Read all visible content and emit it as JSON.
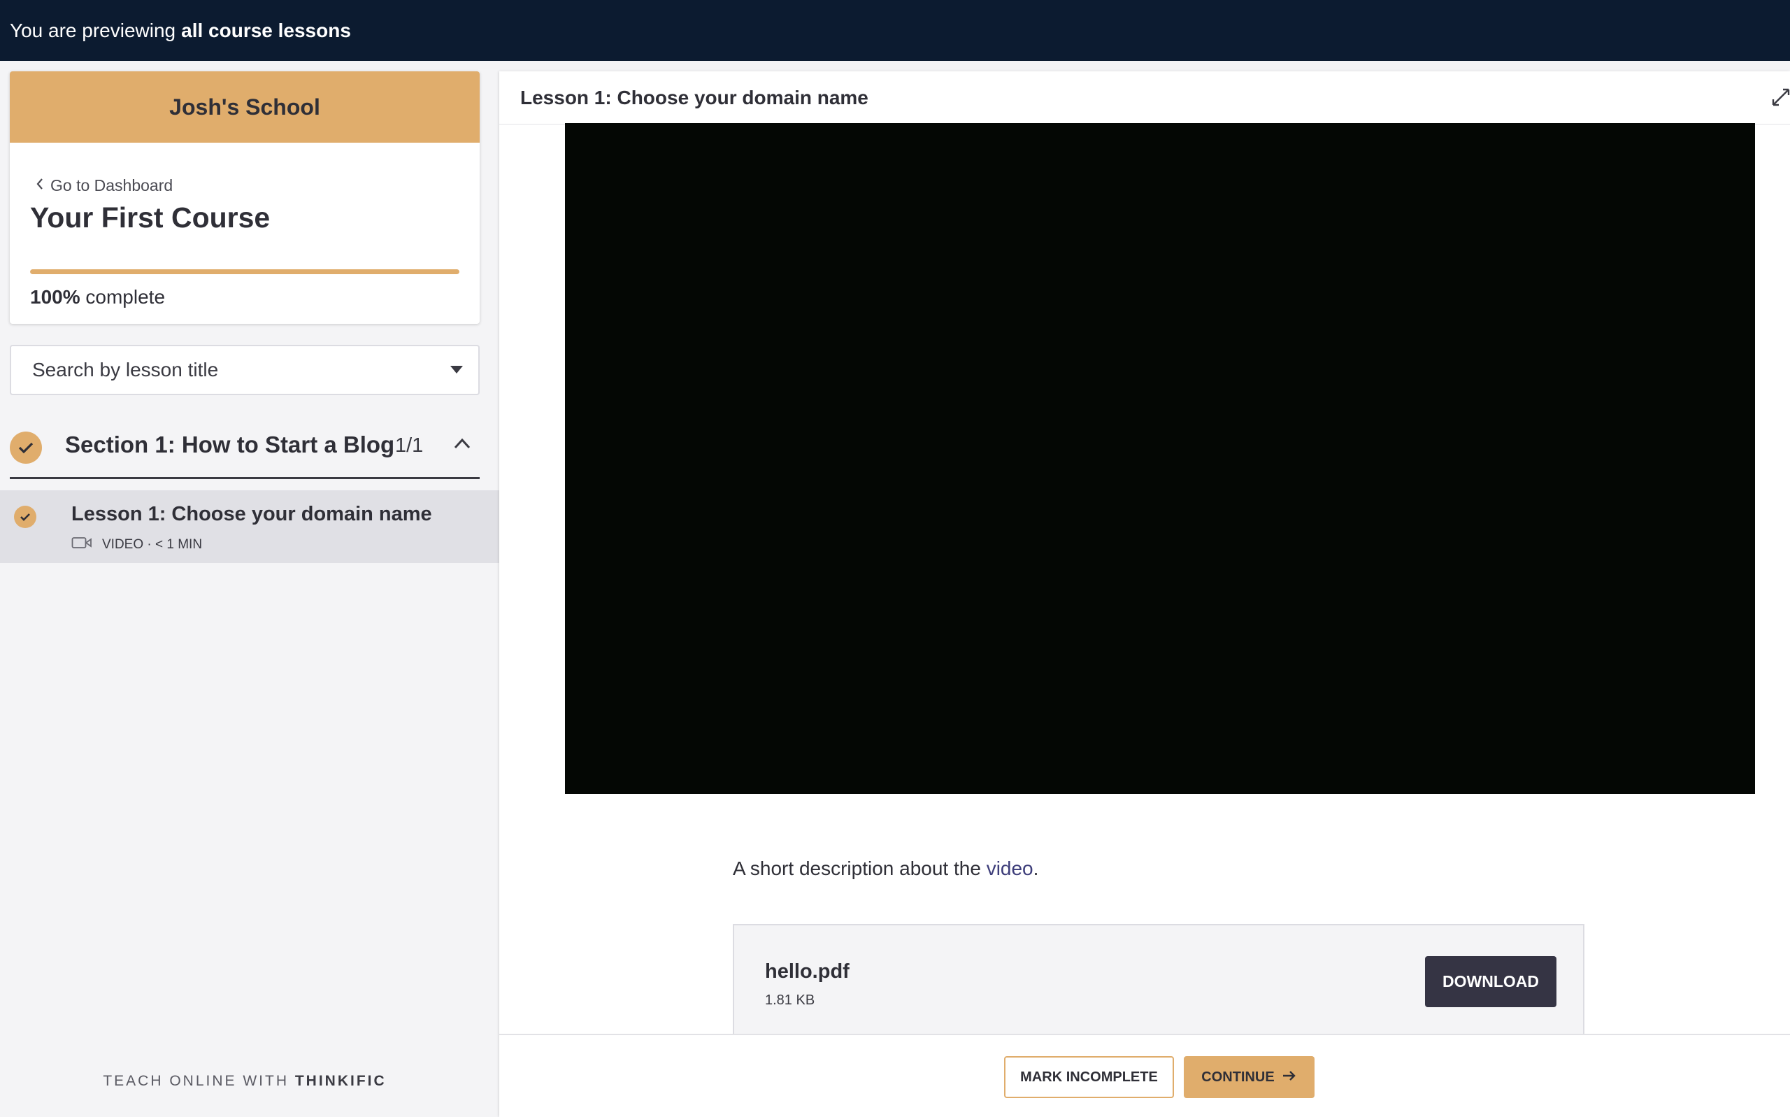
{
  "preview_bar": {
    "prefix": "You are previewing",
    "highlight": "all course lessons"
  },
  "sidebar": {
    "school_name": "Josh's School",
    "back_link": "Go to Dashboard",
    "course_title": "Your First Course",
    "progress_percent": 100,
    "progress_value": "100%",
    "progress_suffix": "complete",
    "search_placeholder": "Search by lesson title",
    "section": {
      "title": "Section 1: How to Start a Blog",
      "count": "1/1",
      "completed": true,
      "expanded": true
    },
    "lessons": [
      {
        "title": "Lesson 1: Choose your domain name",
        "meta": "VIDEO · < 1 MIN",
        "completed": true,
        "type_icon": "video-camera-icon"
      }
    ],
    "footer_prefix": "TEACH ONLINE WITH",
    "footer_brand": "THINKIFIC"
  },
  "main": {
    "lesson_title": "Lesson 1: Choose your domain name",
    "description_prefix": "A short description about the",
    "description_link": "video",
    "description_suffix": ".",
    "file": {
      "name": "hello.pdf",
      "size": "1.81 KB",
      "download_label": "DOWNLOAD"
    },
    "mark_incomplete_label": "MARK INCOMPLETE",
    "continue_label": "CONTINUE"
  },
  "colors": {
    "accent": "#e0ad6c",
    "topbar": "#0c1b30",
    "dark_button": "#353444"
  }
}
